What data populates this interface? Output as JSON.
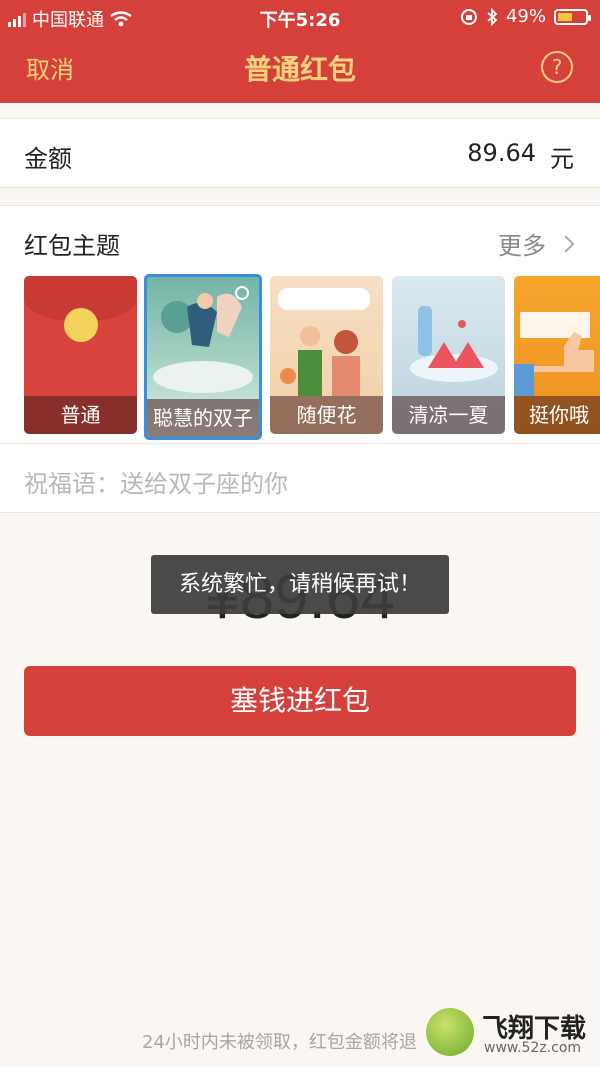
{
  "status_bar": {
    "carrier": "中国联通",
    "time": "下午5:26",
    "battery": "49%"
  },
  "nav": {
    "cancel": "取消",
    "title": "普通红包",
    "help": "?"
  },
  "amount": {
    "label": "金额",
    "value": "89.64",
    "unit": "元"
  },
  "theme": {
    "label": "红包主题",
    "more": "更多",
    "items": [
      {
        "label": "普通"
      },
      {
        "label": "聪慧的双子"
      },
      {
        "label": "随便花"
      },
      {
        "label": "清凉一夏"
      },
      {
        "label": "挺你哦"
      }
    ],
    "selected_index": 1
  },
  "blessing": {
    "label": "祝福语：",
    "text": "送给双子座的你"
  },
  "big_amount": "¥89.64",
  "toast": "系统繁忙，请稍候再试！",
  "submit": "塞钱进红包",
  "footer_note": "24小时内未被领取，红包金额将退",
  "watermark": {
    "name": "飞翔下载",
    "url": "www.52z.com"
  },
  "colors": {
    "header": "#d6403b",
    "accent_text": "#f6d27c",
    "selected_border": "#3a8fdc"
  }
}
